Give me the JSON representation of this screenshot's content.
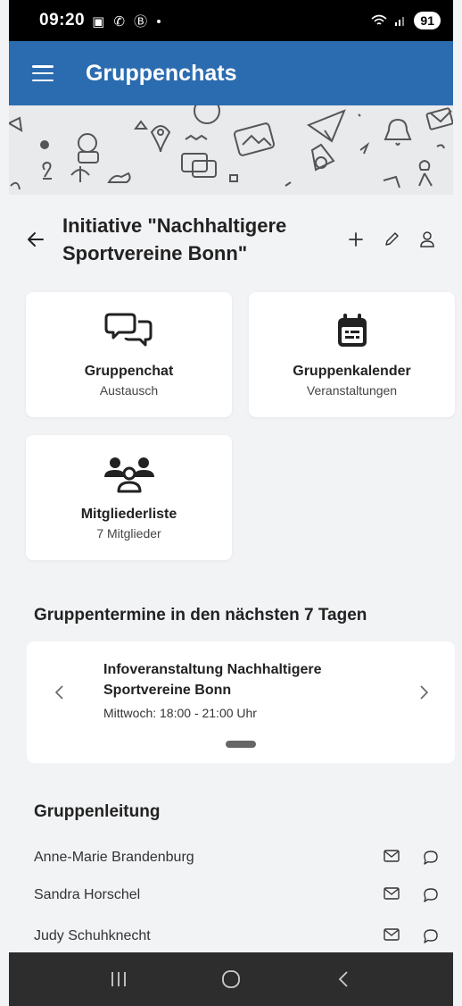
{
  "status_bar": {
    "time": "09:20",
    "notification_icons": "▣ ✆ Ⓑ •",
    "battery": "91"
  },
  "app_bar": {
    "title": "Gruppenchats"
  },
  "group": {
    "title": "Initiative \"Nachhaltigere Sportvereine Bonn\""
  },
  "tiles": [
    {
      "label": "Gruppenchat",
      "sub": "Austausch",
      "icon": "chat-bubbles-icon"
    },
    {
      "label": "Gruppenkalender",
      "sub": "Veranstaltungen",
      "icon": "calendar-icon"
    },
    {
      "label": "Mitgliederliste",
      "sub": "7 Mitglieder",
      "icon": "group-icon"
    }
  ],
  "events_section": {
    "title": "Gruppentermine in den nächsten 7 Tagen",
    "event": {
      "title": "Infoveranstaltung Nachhaltigere Sportvereine Bonn",
      "time": "Mittwoch: 18:00 - 21:00 Uhr"
    }
  },
  "leaders_section": {
    "title": "Gruppenleitung",
    "leaders": [
      "Anne-Marie Brandenburg",
      "Sandra Horschel",
      "Judy Schuhknecht"
    ]
  },
  "colors": {
    "app_bar": "#2b6cb0",
    "background": "#f2f3f5",
    "nav_bar": "#2d2d2d"
  }
}
